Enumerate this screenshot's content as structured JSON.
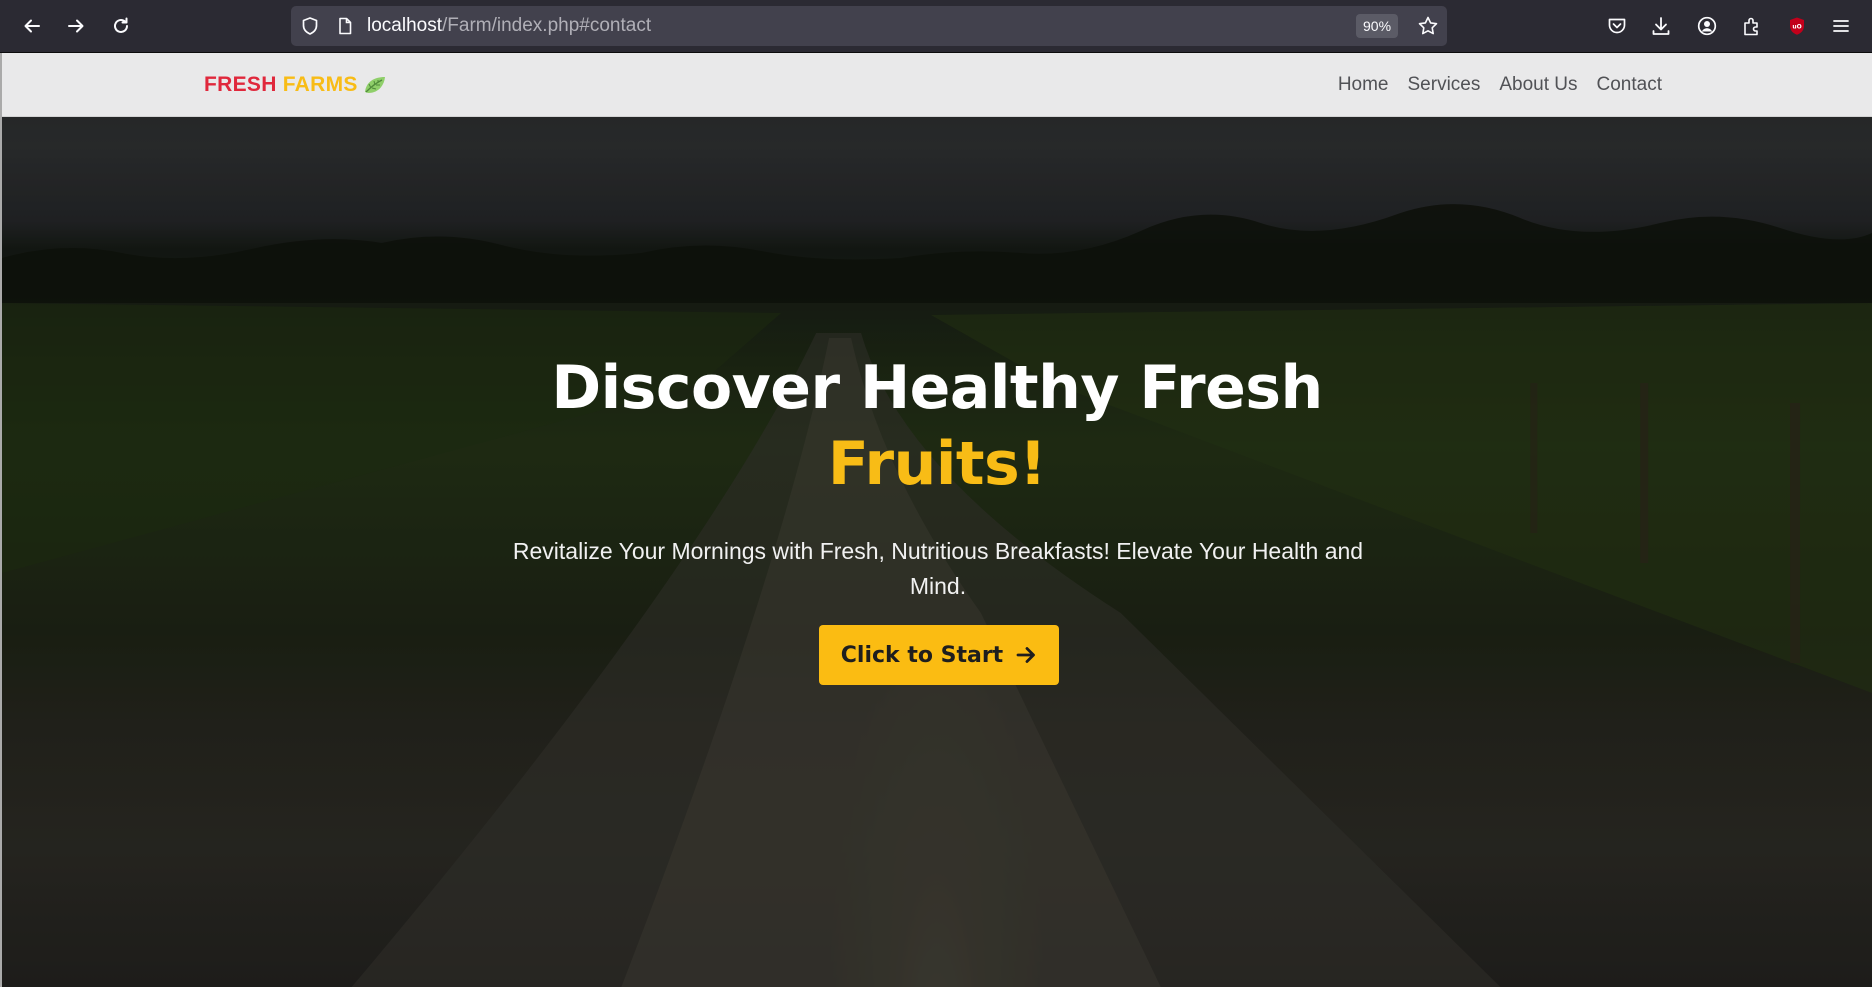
{
  "browser": {
    "url_host": "localhost",
    "url_path": "/Farm/index.php#contact",
    "zoom": "90%",
    "icons": [
      "back-icon",
      "forward-icon",
      "reload-icon",
      "shield-icon",
      "page-icon",
      "star-icon",
      "pocket-icon",
      "download-icon",
      "account-icon",
      "extensions-icon",
      "ublock-icon",
      "menu-icon"
    ]
  },
  "navbar": {
    "brand_word1": "FRESH",
    "brand_word2": "FARMS",
    "brand_icon": "leaf-icon",
    "links": [
      "Home",
      "Services",
      "About Us",
      "Contact"
    ]
  },
  "hero": {
    "title_line1": "Discover Healthy Fresh",
    "title_accent": "Fruits!",
    "subtitle": "Revitalize Your Mornings with Fresh, Nutritious Breakfasts! Elevate Your Health and Mind.",
    "cta_label": "Click to Start",
    "cta_icon": "arrow-right-icon"
  },
  "colors": {
    "accent": "#fbbc12",
    "brand_red": "#e0283c",
    "navbar_bg": "#e9e9ea",
    "chrome_bg": "#2b2a33"
  }
}
